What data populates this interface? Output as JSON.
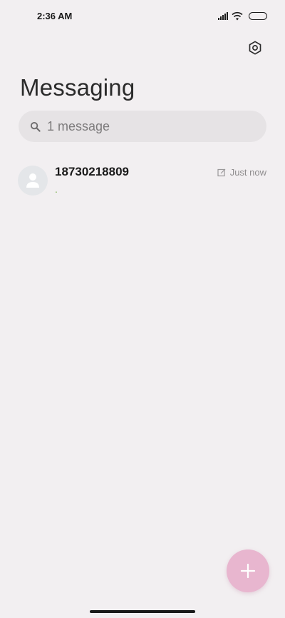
{
  "status_bar": {
    "time": "2:36 AM"
  },
  "header": {
    "title": "Messaging"
  },
  "search": {
    "placeholder": "1 message"
  },
  "conversations": [
    {
      "name": "18730218809",
      "snippet": ".",
      "time": "Just now"
    }
  ],
  "colors": {
    "background": "#f2eff1",
    "search_bg": "#e6e3e5",
    "fab": "#e8b6cf",
    "avatar_bg": "#e4e6e9"
  },
  "icons": [
    "signal-icon",
    "wifi-icon",
    "battery-icon",
    "settings-icon",
    "search-icon",
    "avatar-person-icon",
    "draft-icon",
    "plus-icon"
  ]
}
